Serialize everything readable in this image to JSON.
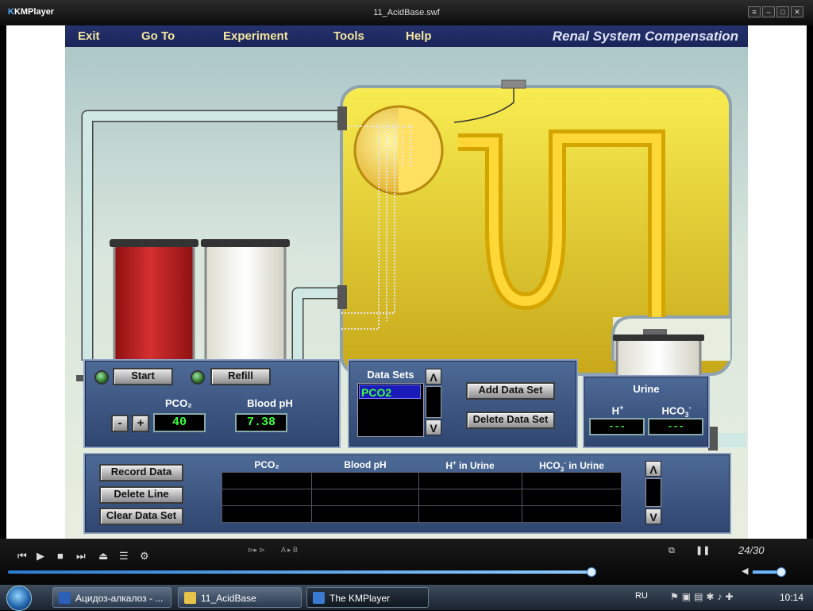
{
  "window": {
    "logo": "KMPlayer",
    "title": "11_AcidBase.swf",
    "btn_menu": "≡",
    "btn_min": "–",
    "btn_max": "□",
    "btn_close": "✕"
  },
  "app": {
    "title": "Renal System Compensation",
    "menu": [
      "Exit",
      "Go To",
      "Experiment",
      "Tools",
      "Help"
    ]
  },
  "control_panel": {
    "start_label": "Start",
    "refill_label": "Refill",
    "pco2_label": "PCO₂",
    "pco2_value": "40",
    "minus_label": "-",
    "plus_label": "+",
    "ph_label": "Blood pH",
    "ph_value": "7.38"
  },
  "datasets": {
    "label": "Data Sets",
    "items": [
      "PCO2"
    ],
    "up_label": "Λ",
    "down_label": "V",
    "add_label": "Add Data Set",
    "delete_label": "Delete Data Set"
  },
  "urine": {
    "label": "Urine",
    "h_label": "H",
    "h_sup": "+",
    "h_value": "---",
    "hco3_label": "HCO",
    "hco3_sub": "3",
    "hco3_sup": "-",
    "hco3_value": "---"
  },
  "data_table": {
    "record_label": "Record Data",
    "delete_line_label": "Delete Line",
    "clear_label": "Clear Data Set",
    "col_pco2": "PCO₂",
    "col_ph": "Blood pH",
    "col_h": "H",
    "col_h_sup": "+",
    "col_h_suffix": " in Urine",
    "col_hco3": "HCO",
    "col_hco3_sub": "3",
    "col_hco3_sup": "-",
    "col_hco3_suffix": " in Urine",
    "up_label": "Λ",
    "down_label": "V"
  },
  "player": {
    "ab_controls": "A ▸ B",
    "speed_controls": "⊳▸ ⊳",
    "page_indicator": "24/30"
  },
  "taskbar": {
    "tasks": [
      "Ацидоз-алкалоз - ...",
      "11_AcidBase",
      "The KMPlayer"
    ],
    "language": "RU",
    "clock": "10:14"
  }
}
